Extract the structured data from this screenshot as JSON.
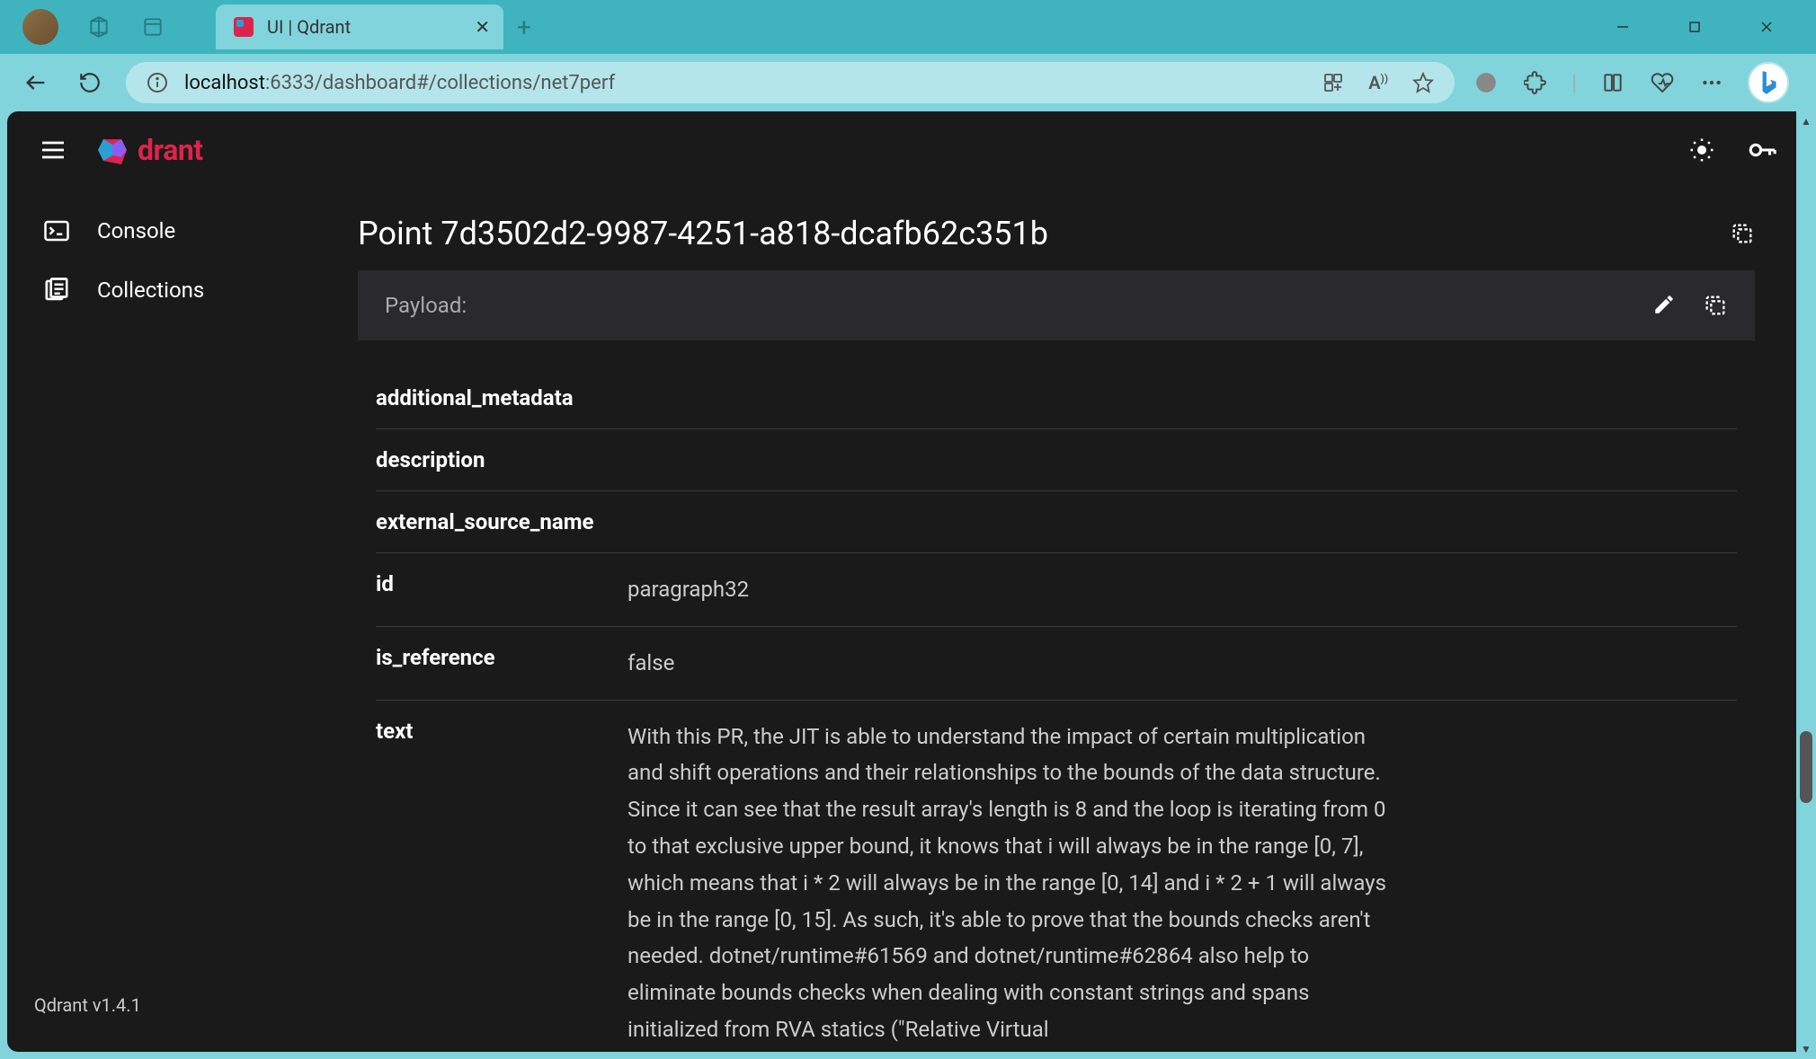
{
  "browser": {
    "tab_title": "UI | Qdrant",
    "url_host": "localhost",
    "url_port_path": ":6333/dashboard#/collections/net7perf"
  },
  "app": {
    "logo_text": "drant",
    "version": "Qdrant v1.4.1",
    "sidebar": {
      "console": "Console",
      "collections": "Collections"
    },
    "point": {
      "title": "Point 7d3502d2-9987-4251-a818-dcafb62c351b",
      "payload_label": "Payload:",
      "fields": [
        {
          "key": "additional_metadata",
          "value": ""
        },
        {
          "key": "description",
          "value": ""
        },
        {
          "key": "external_source_name",
          "value": ""
        },
        {
          "key": "id",
          "value": "paragraph32"
        },
        {
          "key": "is_reference",
          "value": "false"
        },
        {
          "key": "text",
          "value": "With this PR, the JIT is able to understand the impact of certain multiplication and shift operations and their relationships to the bounds of the data structure. Since it can see that the result array's length is 8 and the loop is iterating from 0 to that exclusive upper bound, it knows that i will always be in the range [0, 7], which means that i * 2 will always be in the range [0, 14] and i * 2 + 1 will always be in the range [0, 15]. As such, it's able to prove that the bounds checks aren't needed. dotnet/runtime#61569 and dotnet/runtime#62864 also help to eliminate bounds checks when dealing with constant strings and spans initialized from RVA statics (\"Relative Virtual"
        }
      ]
    }
  }
}
